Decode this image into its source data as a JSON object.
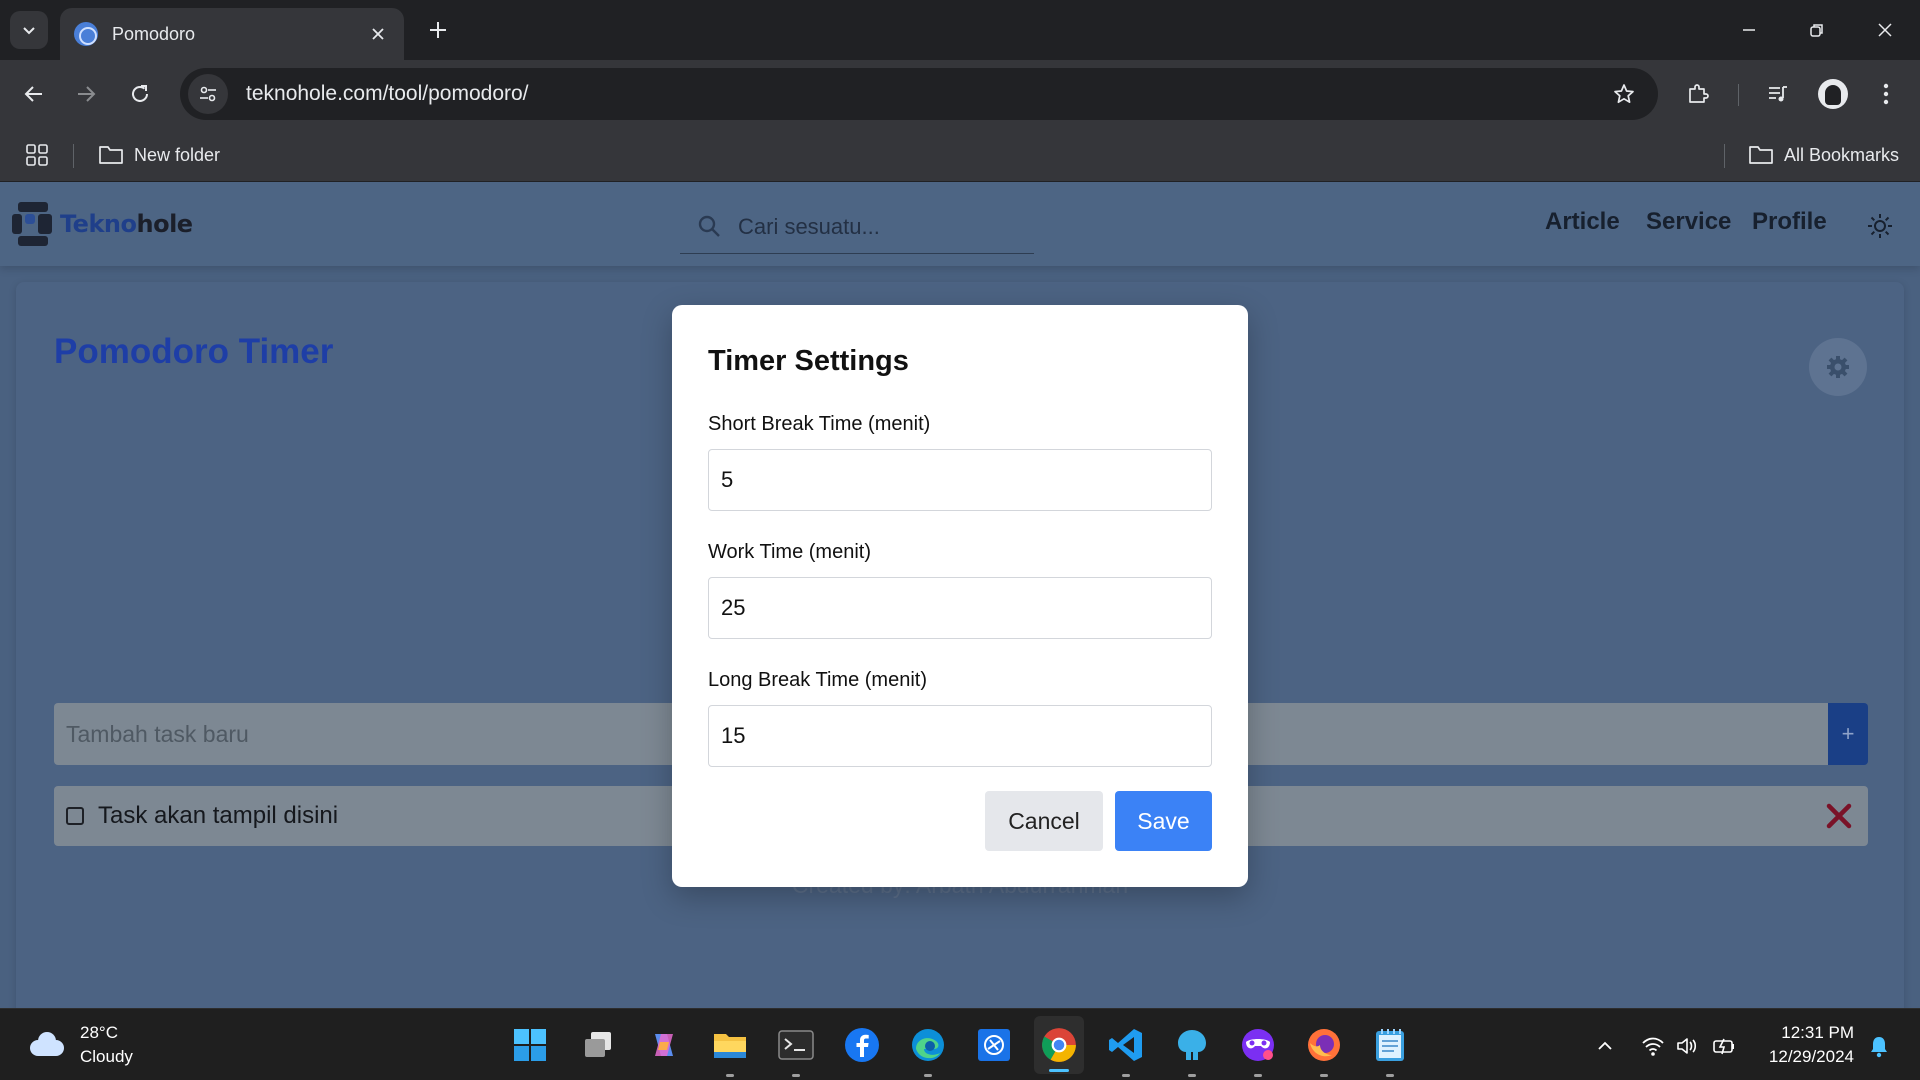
{
  "browser": {
    "tab_title": "Pomodoro",
    "url": "teknohole.com/tool/pomodoro/",
    "bookmarks": [
      {
        "label": "New folder"
      },
      {
        "label": "All Bookmarks"
      }
    ]
  },
  "site": {
    "logo_part1": "Tekno",
    "logo_part2": "hole",
    "search_placeholder": "Cari sesuatu...",
    "nav": [
      "Article",
      "Service",
      "Profile"
    ],
    "colors": {
      "accent": "#1e3ea6",
      "overlay": "#4a6180"
    }
  },
  "pomodoro": {
    "title": "Pomodoro Timer",
    "task_placeholder": "Tambah task baru",
    "add_label": "+",
    "task_item": "Task akan tampil disini",
    "credit": "Created by: Arbath Abdurrahman"
  },
  "modal": {
    "title": "Timer Settings",
    "fields": [
      {
        "label": "Short Break Time (menit)",
        "value": "5"
      },
      {
        "label": "Work Time (menit)",
        "value": "25"
      },
      {
        "label": "Long Break Time (menit)",
        "value": "15"
      }
    ],
    "cancel_label": "Cancel",
    "save_label": "Save",
    "colors": {
      "save": "#3b82f6",
      "cancel": "#e5e7eb"
    }
  },
  "taskbar": {
    "temperature": "28°C",
    "condition": "Cloudy",
    "time": "12:31 PM",
    "date": "12/29/2024",
    "apps": [
      "start-icon",
      "task-view-icon",
      "copilot-icon",
      "file-explorer-icon",
      "terminal-icon",
      "facebook-icon",
      "edge-icon",
      "app-store-icon",
      "chrome-icon",
      "vscode-icon",
      "app-icon",
      "mask-app-icon",
      "firefox-icon",
      "notepad-icon"
    ]
  }
}
